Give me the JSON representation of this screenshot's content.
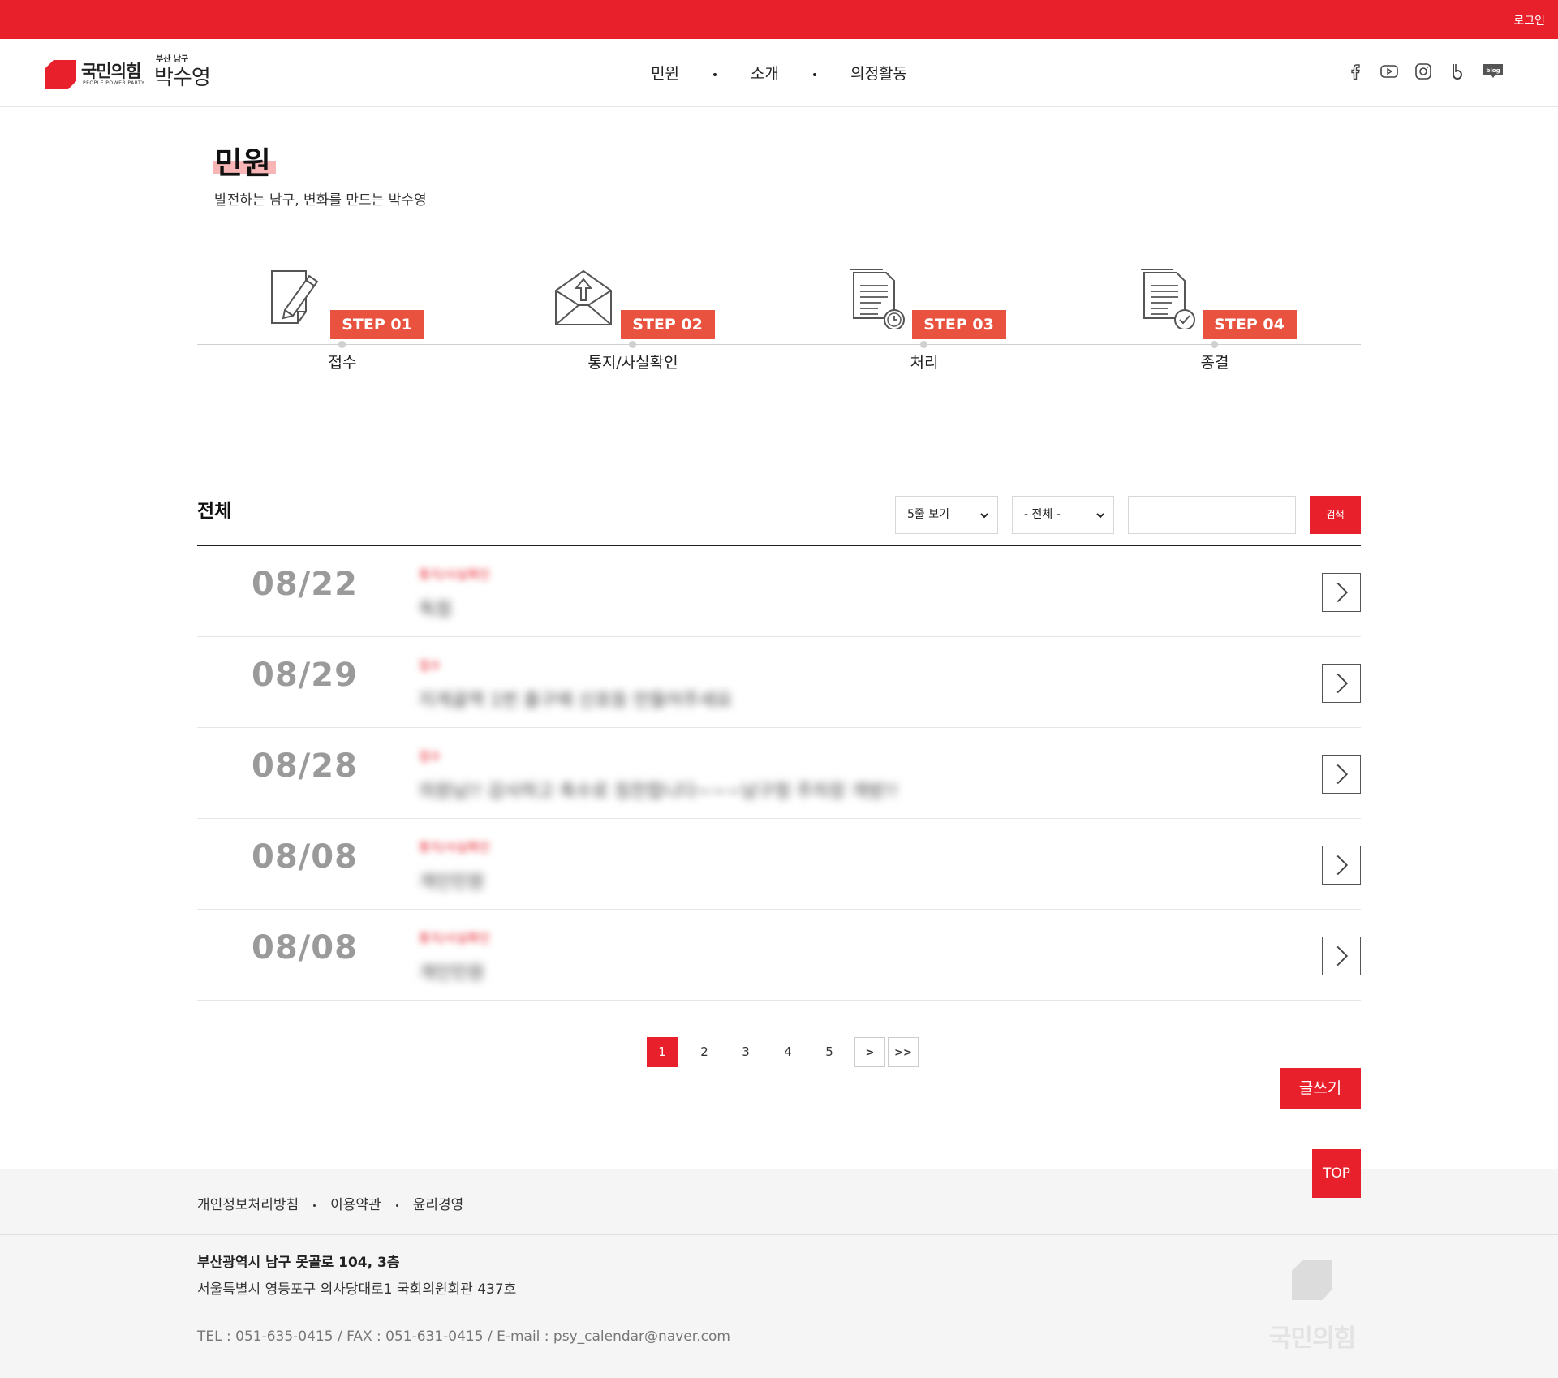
{
  "topbar": {
    "login": "로그인"
  },
  "brand": {
    "party": "국민의힘",
    "party_en": "PEOPLE POWER PARTY",
    "region": "부산 남구",
    "name": "박수영"
  },
  "nav": {
    "items": [
      "민원",
      "소개",
      "의정활동"
    ]
  },
  "social": [
    "facebook-icon",
    "youtube-icon",
    "instagram-icon",
    "band-icon",
    "blog-icon"
  ],
  "social_blog_label": "blog",
  "page": {
    "title": "민원",
    "subtitle": "발전하는 남구, 변화를 만드는 박수영"
  },
  "steps": [
    {
      "badge": "STEP 01",
      "label": "접수",
      "icon": "pencil-document-icon"
    },
    {
      "badge": "STEP 02",
      "label": "통지/사실확인",
      "icon": "envelope-upload-icon"
    },
    {
      "badge": "STEP 03",
      "label": "처리",
      "icon": "document-clock-icon"
    },
    {
      "badge": "STEP 04",
      "label": "종결",
      "icon": "document-check-icon"
    }
  ],
  "list": {
    "heading": "전체",
    "rows_select": "5줄 보기",
    "category_select": "- 전체 -",
    "search_value": "",
    "search_button": "검색",
    "rows": [
      {
        "date": "08/22",
        "status": "통지/사실확인",
        "title": "독점"
      },
      {
        "date": "08/29",
        "status": "접수",
        "title": "지게골역 1번 출구에 신호등 만들어주세요"
      },
      {
        "date": "08/28",
        "status": "접수",
        "title": "의원님!! 감사하고 축수로 칭찬합니다~~~남구청 주차장 개방!!"
      },
      {
        "date": "08/08",
        "status": "통지/사실확인",
        "title": "개인민원"
      },
      {
        "date": "08/08",
        "status": "통지/사실확인",
        "title": "개인민원"
      }
    ]
  },
  "pagination": {
    "pages": [
      "1",
      "2",
      "3",
      "4",
      "5"
    ],
    "current": "1",
    "next": ">",
    "last": ">>"
  },
  "write_button": "글쓰기",
  "top_button": "TOP",
  "footer": {
    "links": [
      "개인정보처리방침",
      "이용약관",
      "윤리경영"
    ],
    "address1": "부산광역시 남구 못골로 104, 3층",
    "address2": "서울특별시 영등포구 의사당대로1 국회의원회관 437호",
    "contact": "TEL : 051-635-0415 / FAX : 051-631-0415 / E-mail : psy_calendar@naver.com",
    "logo_text": "국민의힘"
  },
  "colors": {
    "brand_red": "#e8202b",
    "step_badge": "#e8523f",
    "date_gray": "#9a9a9a"
  }
}
